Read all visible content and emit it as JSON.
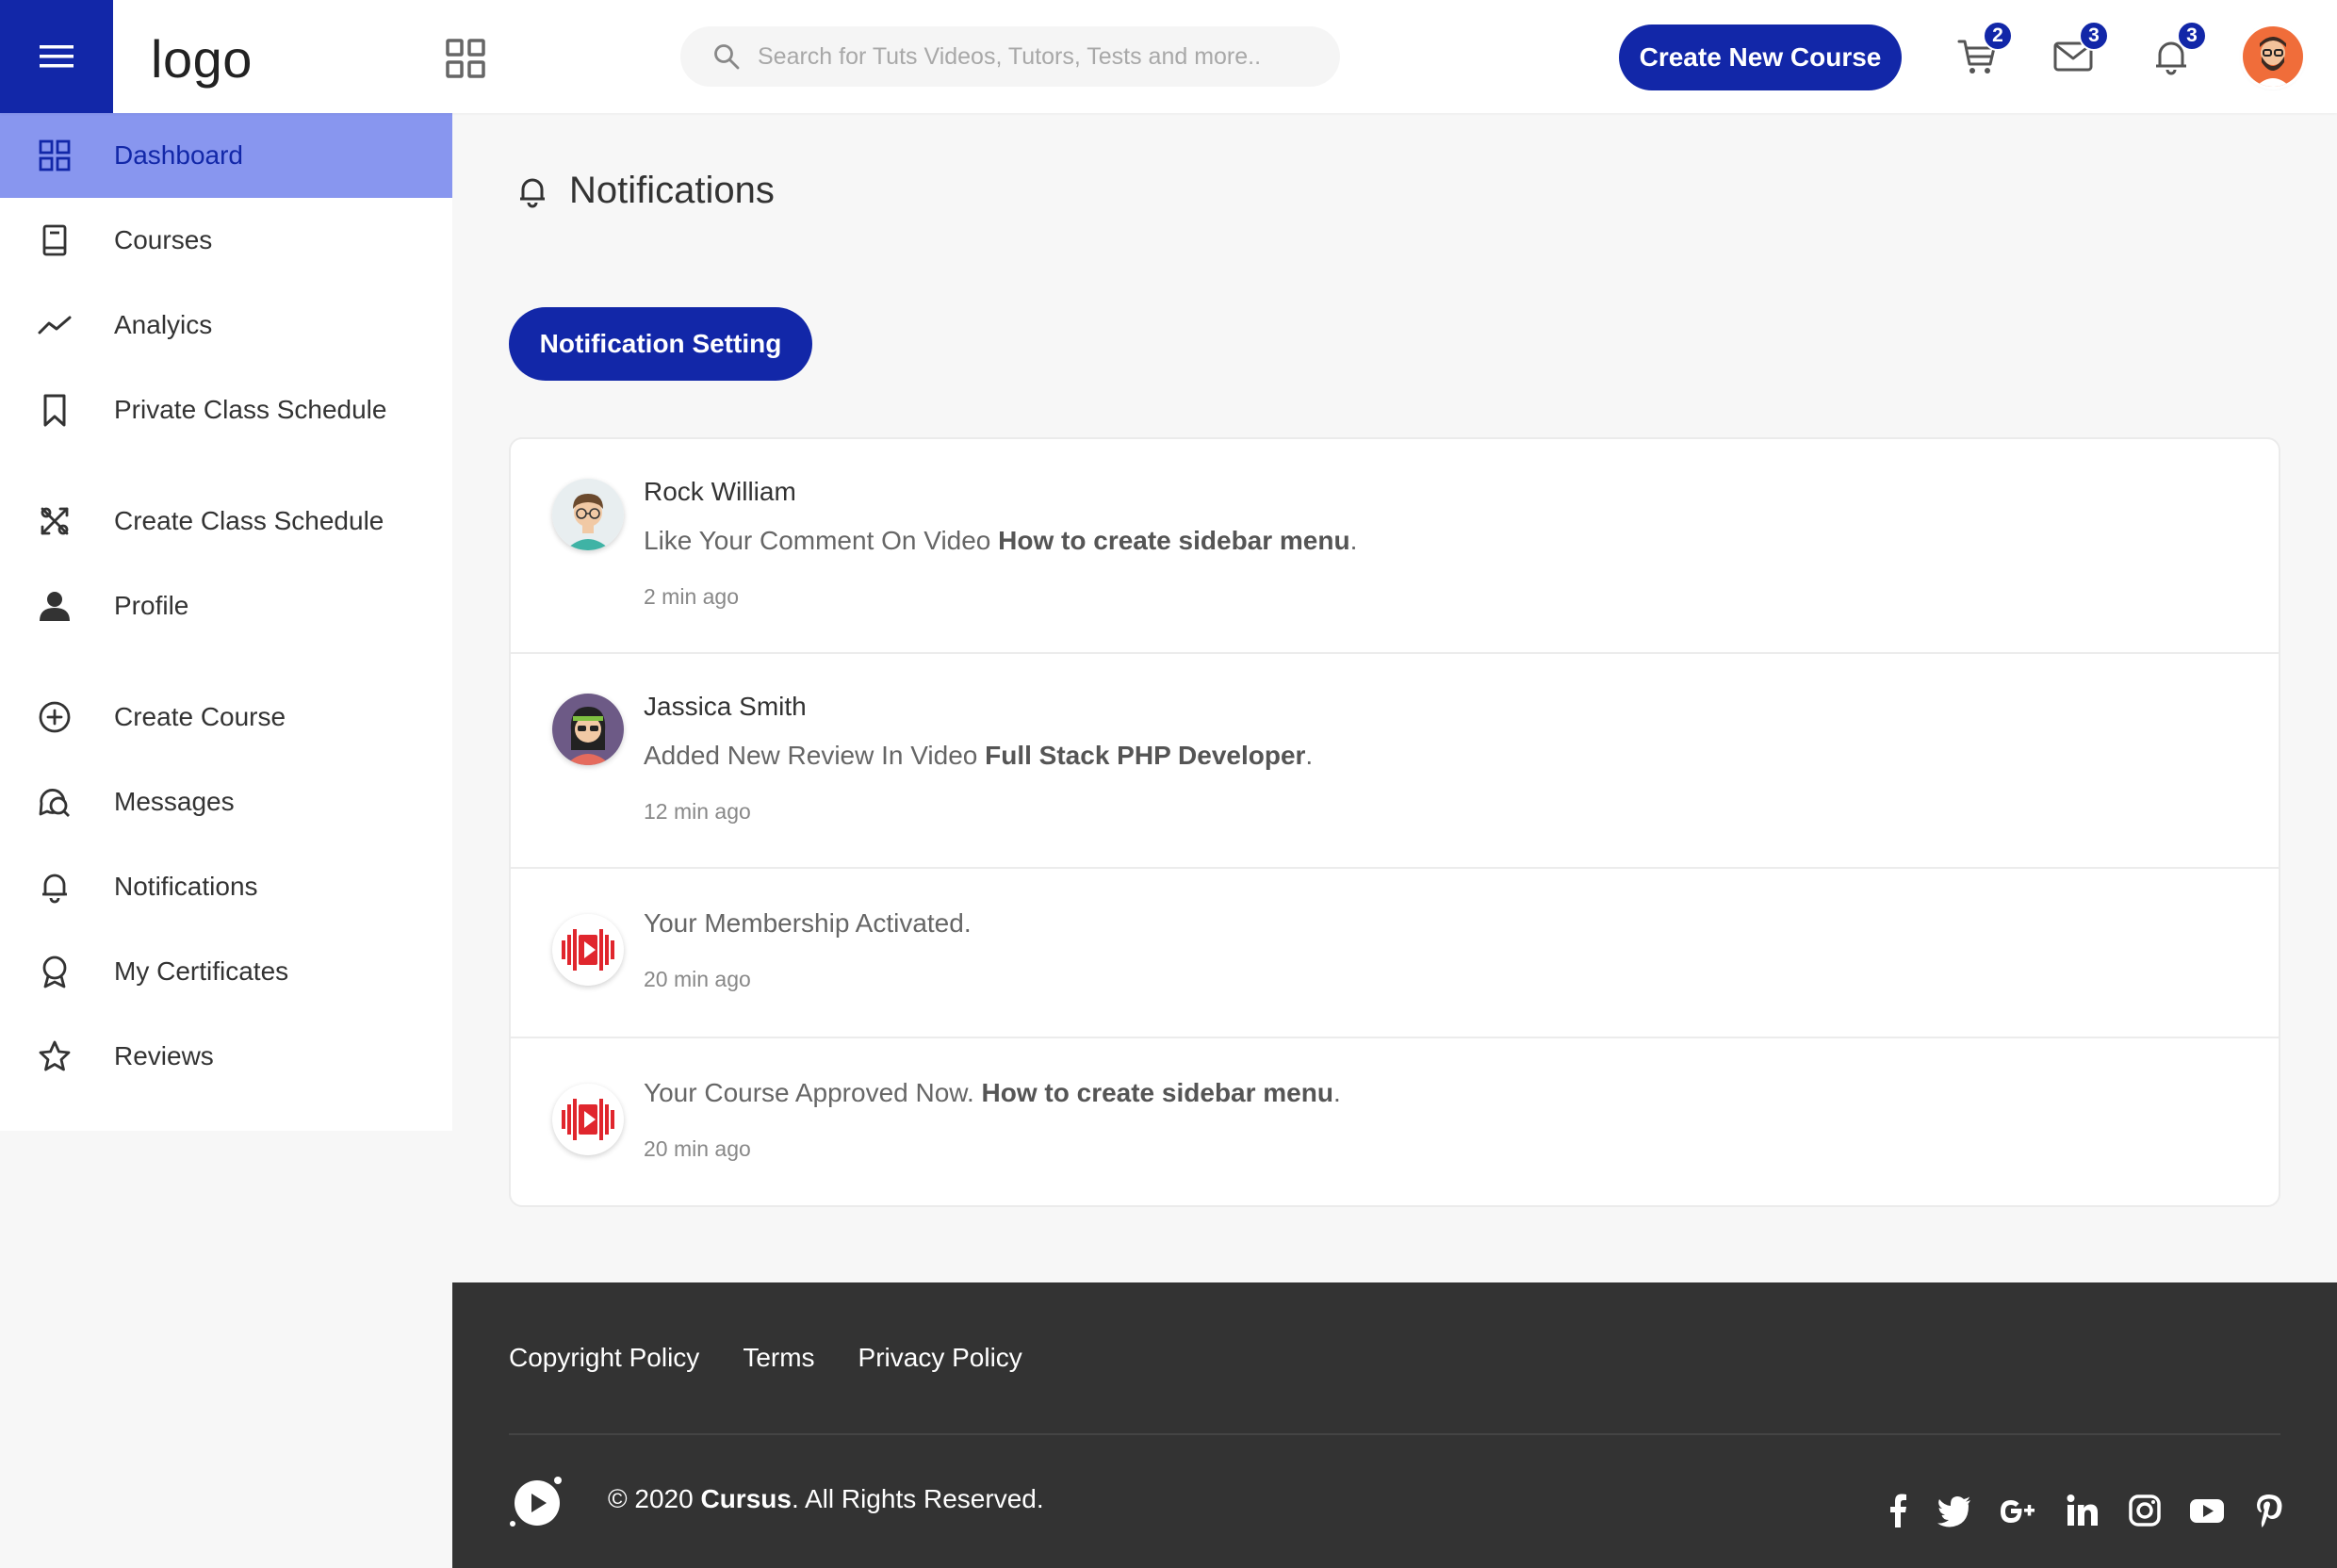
{
  "header": {
    "logo": "logo",
    "search_placeholder": "Search for Tuts Videos, Tutors, Tests and more..",
    "create_button": "Create New Course",
    "cart_count": "2",
    "messages_count": "3",
    "notifications_count": "3"
  },
  "sidebar": {
    "items": [
      {
        "label": "Dashboard",
        "icon": "grid-icon"
      },
      {
        "label": "Courses",
        "icon": "book-icon"
      },
      {
        "label": "Analyics",
        "icon": "trend-icon"
      },
      {
        "label": "Private Class Schedule",
        "icon": "bookmark-icon"
      },
      {
        "label": "Create Class Schedule",
        "icon": "tools-icon"
      },
      {
        "label": "Profile",
        "icon": "user-icon"
      },
      {
        "label": "Create Course",
        "icon": "plus-circle-icon"
      },
      {
        "label": "Messages",
        "icon": "chat-icon"
      },
      {
        "label": "Notifications",
        "icon": "bell-icon"
      },
      {
        "label": "My Certificates",
        "icon": "award-icon"
      },
      {
        "label": "Reviews",
        "icon": "star-icon"
      }
    ]
  },
  "main": {
    "title": "Notifications",
    "setting_button": "Notification Setting",
    "notifications": [
      {
        "name": "Rock William",
        "text": "Like Your Comment On Video ",
        "bold": "How to create sidebar menu",
        "tail": ".",
        "time": "2 min ago"
      },
      {
        "name": "Jassica Smith",
        "text": "Added New Review In Video ",
        "bold": "Full Stack PHP Developer",
        "tail": ".",
        "time": "12 min ago"
      },
      {
        "name": "",
        "text": "Your Membership Activated.",
        "bold": "",
        "tail": "",
        "time": "20 min ago"
      },
      {
        "name": "",
        "text": "Your Course Approved Now. ",
        "bold": "How to create sidebar menu",
        "tail": ".",
        "time": "20 min ago"
      }
    ]
  },
  "footer": {
    "links": [
      "Copyright Policy",
      "Terms",
      "Privacy Policy"
    ],
    "copy_prefix": "© 2020 ",
    "copy_brand": "Cursus",
    "copy_suffix": ". All Rights Reserved."
  },
  "colors": {
    "primary": "#1227a8",
    "active_bg": "#8896ef",
    "footer_bg": "#333333"
  }
}
